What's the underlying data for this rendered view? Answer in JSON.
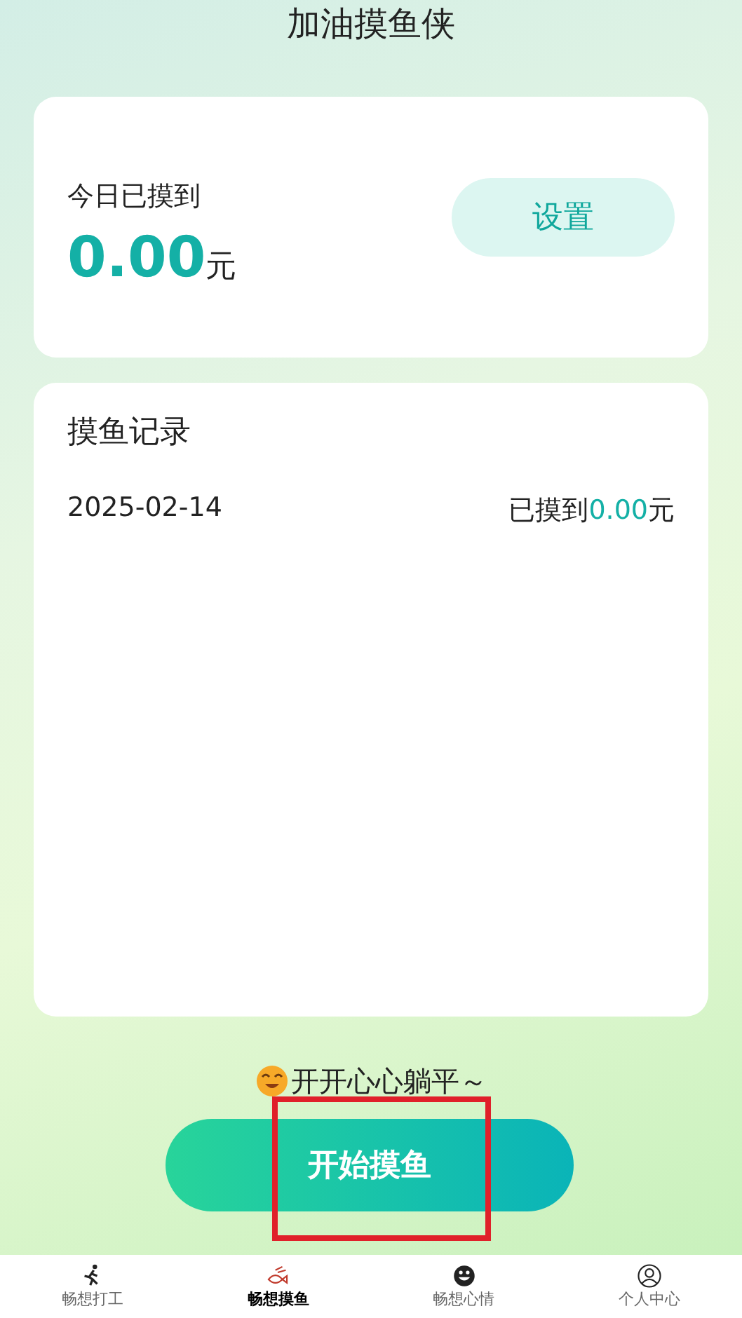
{
  "title": "加油摸鱼侠",
  "today": {
    "label": "今日已摸到",
    "amount": "0.00",
    "unit": "元",
    "button": "设置"
  },
  "records": {
    "heading": "摸鱼记录",
    "items": [
      {
        "date": "2025-02-14",
        "prefix": "已摸到",
        "amount": "0.00",
        "unit": "元"
      }
    ]
  },
  "mood": {
    "text": "开开心心躺平～"
  },
  "start_button": {
    "label": "开始摸鱼",
    "highlighted": true
  },
  "tabs": [
    {
      "label": "畅想打工",
      "kind": "runner",
      "selected": false
    },
    {
      "label": "畅想摸鱼",
      "kind": "fish",
      "selected": true
    },
    {
      "label": "畅想心情",
      "kind": "smiley",
      "selected": false
    },
    {
      "label": "个人中心",
      "kind": "person",
      "selected": false
    }
  ]
}
